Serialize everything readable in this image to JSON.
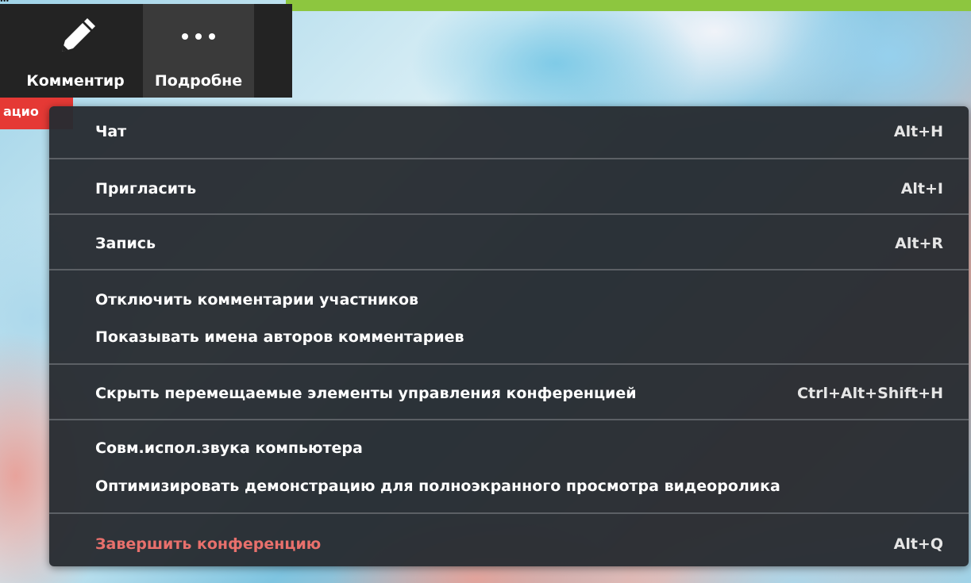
{
  "caption": "...",
  "colors": {
    "accent_stripe": "#8dc63f",
    "toolbar_bg": "#232323",
    "menu_bg": "#2b2f33",
    "danger_text": "#e8706c",
    "tag_red": "#e53935"
  },
  "toolbar": {
    "annotate": {
      "label": "Комментир",
      "icon": "pencil-icon"
    },
    "more": {
      "label": "Подробне",
      "icon": "more-dots-icon"
    }
  },
  "red_tag": {
    "text": "ацио"
  },
  "menu": {
    "chat": {
      "label": "Чат",
      "shortcut": "Alt+H"
    },
    "invite": {
      "label": "Пригласить",
      "shortcut": "Alt+I"
    },
    "record": {
      "label": "Запись",
      "shortcut": "Alt+R"
    },
    "disable_annotation": {
      "label": "Отключить комментарии участников"
    },
    "show_names": {
      "label": "Показывать имена авторов комментариев"
    },
    "hide_controls": {
      "label": "Скрыть перемещаемые элементы управления конференцией",
      "shortcut": "Ctrl+Alt+Shift+H"
    },
    "share_sound": {
      "label": "Совм.испол.звука компьютера"
    },
    "optimize_video": {
      "label": "Оптимизировать демонстрацию для полноэкранного просмотра видеоролика"
    },
    "end_meeting": {
      "label": "Завершить конференцию",
      "shortcut": "Alt+Q"
    }
  }
}
